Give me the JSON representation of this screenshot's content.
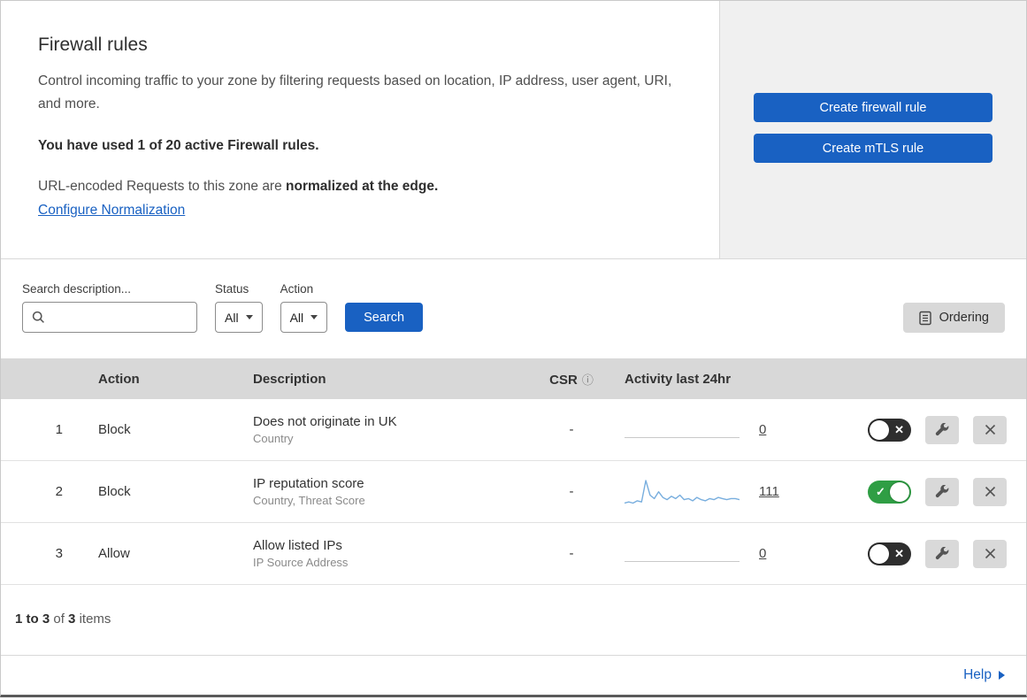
{
  "header": {
    "title": "Firewall rules",
    "description": "Control incoming traffic to your zone by filtering requests based on location, IP address, user agent, URI, and more.",
    "usage": "You have used 1 of 20 active Firewall rules.",
    "normalization_text": "URL-encoded Requests to this zone are",
    "normalization_bold": "normalized at the edge.",
    "normalization_link": "Configure Normalization",
    "create_firewall_button": "Create firewall rule",
    "create_mtls_button": "Create mTLS rule"
  },
  "filters": {
    "search_label": "Search description...",
    "status_label": "Status",
    "status_value": "All",
    "action_label": "Action",
    "action_value": "All",
    "search_button": "Search",
    "ordering_button": "Ordering"
  },
  "table": {
    "headers": {
      "action": "Action",
      "description": "Description",
      "csr": "CSR",
      "activity": "Activity last 24hr"
    },
    "rows": [
      {
        "index": "1",
        "action": "Block",
        "description": "Does not originate in UK",
        "criteria": "Country",
        "csr": "-",
        "activity": "0",
        "enabled": false
      },
      {
        "index": "2",
        "action": "Block",
        "description": "IP reputation score",
        "criteria": "Country, Threat Score",
        "csr": "-",
        "activity": "111",
        "enabled": true,
        "sparkline": [
          2,
          3,
          2,
          4,
          3,
          22,
          9,
          6,
          12,
          7,
          5,
          8,
          6,
          9,
          5,
          6,
          4,
          7,
          5,
          4,
          6,
          5,
          7,
          6,
          5,
          6,
          6,
          5
        ]
      },
      {
        "index": "3",
        "action": "Allow",
        "description": "Allow listed IPs",
        "criteria": "IP Source Address",
        "csr": "-",
        "activity": "0",
        "enabled": false
      }
    ]
  },
  "footer": {
    "range": "1 to 3",
    "of": "of",
    "total": "3",
    "items": "items",
    "help": "Help"
  },
  "icons": {
    "info_glyph": "ⓘ",
    "check_glyph": "✓",
    "cross_glyph": "✕"
  },
  "colors": {
    "accent_blue": "#1961c2",
    "toggle_on_green": "#2f9e44",
    "toggle_off_dark": "#2e2e2e",
    "table_header_gray": "#d8d8d8",
    "panel_gray": "#f0f0f0",
    "sparkline_blue": "#78aede"
  }
}
